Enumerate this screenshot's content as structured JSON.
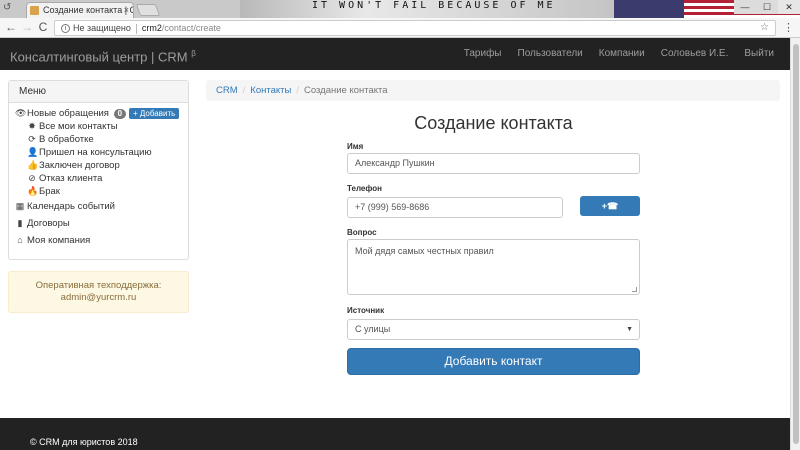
{
  "browser": {
    "tab_title": "Создание контакта | CR",
    "tab_close": "×",
    "banner_text": "IT WON'T FAIL BECAUSE OF ME",
    "win_min": "—",
    "win_max": "☐",
    "win_close": "✕",
    "back": "←",
    "forward": "→",
    "reload": "C",
    "info_glyph": "i",
    "security_label": "Не защищено",
    "url_host": "crm2",
    "url_path": "/contact/create",
    "bookmark_glyph": "☆",
    "menu_glyph": "⋮"
  },
  "navbar": {
    "brand": "Консалтинговый центр | CRM",
    "brand_sup": "β",
    "links": [
      "Тарифы",
      "Пользователи",
      "Компании",
      "Соловьев И.Е.",
      "Выйти"
    ]
  },
  "sidebar": {
    "heading": "Меню",
    "new_requests": "Новые обращения",
    "new_requests_count": "0",
    "add_button": "+ Добавить",
    "sub_items": [
      "Все мои контакты",
      "В обработке",
      "Пришел на консультацию",
      "Заключен договор",
      "Отказ клиента",
      "Брак"
    ],
    "items": [
      "Календарь событий",
      "Договоры",
      "Моя компания"
    ]
  },
  "support": {
    "line1": "Оперативная техподдержка:",
    "line2": "admin@yurcrm.ru"
  },
  "breadcrumb": {
    "crm": "CRM",
    "contacts": "Контакты",
    "current": "Создание контакта",
    "divider": "/"
  },
  "form": {
    "title": "Создание контакта",
    "name_label": "Имя",
    "name_value": "Александр Пушкин",
    "phone_label": "Телефон",
    "phone_value": "+7 (999) 569-8686",
    "phone_button": "+☎",
    "question_label": "Вопрос",
    "question_value": "Мой дядя самых честных правил",
    "source_label": "Источник",
    "source_value": "С улицы",
    "source_arrow": "▼",
    "submit_label": "Добавить контакт"
  },
  "footer": {
    "copyright": "© CRM для юристов 2018"
  },
  "icons": {
    "back_tab": "↺",
    "new_requests": "👁",
    "all_contacts": "✸",
    "in_progress": "⟳",
    "consultation": "👤",
    "contract": "👍",
    "refused": "⊘",
    "defect": "🔥",
    "calendar": "▦",
    "contracts": "▮",
    "company": "⌂"
  },
  "colors": {
    "primary": "#337ab7",
    "navbar": "#222222",
    "alert_bg": "#fcf8e3",
    "alert_text": "#8a6d3b"
  }
}
